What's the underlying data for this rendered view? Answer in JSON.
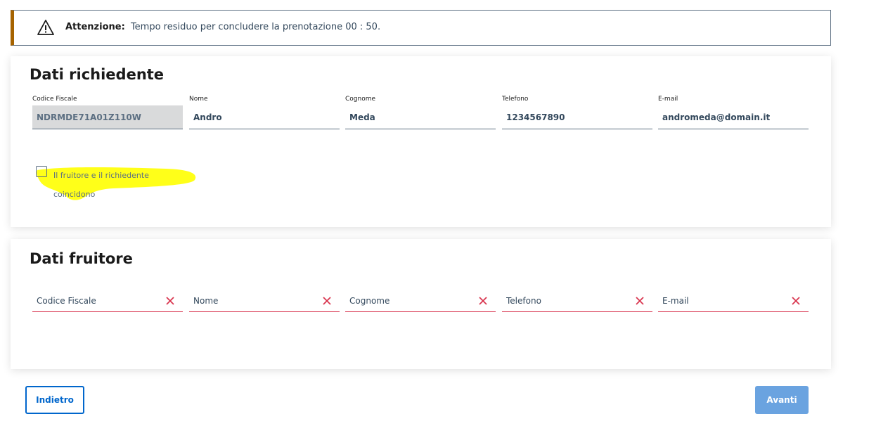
{
  "alert": {
    "icon": "warning-icon",
    "label": "Attenzione:",
    "message": "Tempo residuo per concludere la prenotazione 00 : 50.",
    "accent_color": "#a66300"
  },
  "richiedente": {
    "title": "Dati richiedente",
    "fields": [
      {
        "label": "Codice Fiscale",
        "value": "NDRMDE71A01Z110W"
      },
      {
        "label": "Nome",
        "value": "Andro"
      },
      {
        "label": "Cognome",
        "value": "Meda"
      },
      {
        "label": "Telefono",
        "value": "1234567890"
      },
      {
        "label": "E-mail",
        "value": "andromeda@domain.it"
      }
    ],
    "checkbox": {
      "line1": "Il fruitore e il richiedente",
      "line2": "coincidono",
      "checked": false,
      "highlight_color": "#ffff00"
    }
  },
  "fruitore": {
    "title": "Dati fruitore",
    "fields": [
      {
        "placeholder": "Codice Fiscale"
      },
      {
        "placeholder": "Nome"
      },
      {
        "placeholder": "Cognome"
      },
      {
        "placeholder": "Telefono"
      },
      {
        "placeholder": "E-mail"
      }
    ],
    "error_color": "#d9364f"
  },
  "buttons": {
    "back_label": "Indietro",
    "next_label": "Avanti",
    "primary_color": "#0066cc"
  }
}
